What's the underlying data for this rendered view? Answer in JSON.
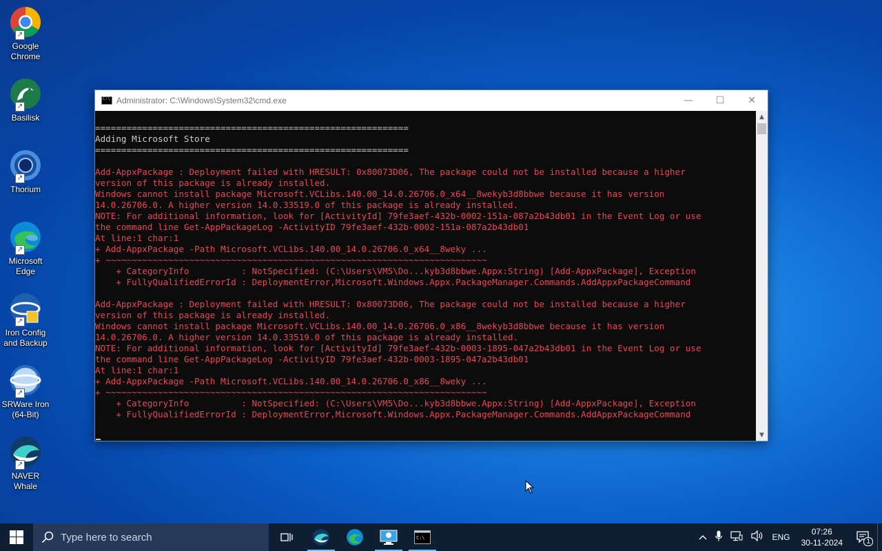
{
  "desktop": {
    "icons": [
      {
        "label": "Google\nChrome",
        "icon": "chrome-icon"
      },
      {
        "label": "Basilisk",
        "icon": "basilisk-icon"
      },
      {
        "label": "Thorium",
        "icon": "thorium-icon"
      },
      {
        "label": "Microsoft\nEdge",
        "icon": "edge-icon"
      },
      {
        "label": "Iron Config\nand Backup",
        "icon": "iron-config-icon"
      },
      {
        "label": "SRWare Iron\n(64-Bit)",
        "icon": "srware-iron-icon"
      },
      {
        "label": "NAVER\nWhale",
        "icon": "naver-whale-icon"
      }
    ]
  },
  "window": {
    "title": "Administrator: C:\\Windows\\System32\\cmd.exe",
    "minimize": "—",
    "maximize": "☐",
    "close": "✕"
  },
  "console": {
    "lines": [
      {
        "text": "============================================================",
        "color": "white"
      },
      {
        "text": "Adding Microsoft Store",
        "color": "white"
      },
      {
        "text": "============================================================",
        "color": "white"
      },
      {
        "text": "",
        "color": "white"
      },
      {
        "text": "Add-AppxPackage : Deployment failed with HRESULT: 0x80073D06, The package could not be installed because a higher",
        "color": "red"
      },
      {
        "text": "version of this package is already installed.",
        "color": "red"
      },
      {
        "text": "Windows cannot install package Microsoft.VCLibs.140.00_14.0.26706.0_x64__8wekyb3d8bbwe because it has version",
        "color": "red"
      },
      {
        "text": "14.0.26706.0. A higher version 14.0.33519.0 of this package is already installed.",
        "color": "red"
      },
      {
        "text": "NOTE: For additional information, look for [ActivityId] 79fe3aef-432b-0002-151a-087a2b43db01 in the Event Log or use",
        "color": "red"
      },
      {
        "text": "the command line Get-AppPackageLog -ActivityID 79fe3aef-432b-0002-151a-087a2b43db01",
        "color": "red"
      },
      {
        "text": "At line:1 char:1",
        "color": "red"
      },
      {
        "text": "+ Add-AppxPackage -Path Microsoft.VCLibs.140.00_14.0.26706.0_x64__8weky ...",
        "color": "red"
      },
      {
        "text": "+ ~~~~~~~~~~~~~~~~~~~~~~~~~~~~~~~~~~~~~~~~~~~~~~~~~~~~~~~~~~~~~~~~~~~~~~~~~",
        "color": "red"
      },
      {
        "text": "    + CategoryInfo          : NotSpecified: (C:\\Users\\VM5\\Do...kyb3d8bbwe.Appx:String) [Add-AppxPackage], Exception",
        "color": "red"
      },
      {
        "text": "    + FullyQualifiedErrorId : DeploymentError,Microsoft.Windows.Appx.PackageManager.Commands.AddAppxPackageCommand",
        "color": "red"
      },
      {
        "text": "",
        "color": "white"
      },
      {
        "text": "Add-AppxPackage : Deployment failed with HRESULT: 0x80073D06, The package could not be installed because a higher",
        "color": "red"
      },
      {
        "text": "version of this package is already installed.",
        "color": "red"
      },
      {
        "text": "Windows cannot install package Microsoft.VCLibs.140.00_14.0.26706.0_x86__8wekyb3d8bbwe because it has version",
        "color": "red"
      },
      {
        "text": "14.0.26706.0. A higher version 14.0.33519.0 of this package is already installed.",
        "color": "red"
      },
      {
        "text": "NOTE: For additional information, look for [ActivityId] 79fe3aef-432b-0003-1895-047a2b43db01 in the Event Log or use",
        "color": "red"
      },
      {
        "text": "the command line Get-AppPackageLog -ActivityID 79fe3aef-432b-0003-1895-047a2b43db01",
        "color": "red"
      },
      {
        "text": "At line:1 char:1",
        "color": "red"
      },
      {
        "text": "+ Add-AppxPackage -Path Microsoft.VCLibs.140.00_14.0.26706.0_x86__8weky ...",
        "color": "red"
      },
      {
        "text": "+ ~~~~~~~~~~~~~~~~~~~~~~~~~~~~~~~~~~~~~~~~~~~~~~~~~~~~~~~~~~~~~~~~~~~~~~~~~",
        "color": "red"
      },
      {
        "text": "    + CategoryInfo          : NotSpecified: (C:\\Users\\VM5\\Do...kyb3d8bbwe.Appx:String) [Add-AppxPackage], Exception",
        "color": "red"
      },
      {
        "text": "    + FullyQualifiedErrorId : DeploymentError,Microsoft.Windows.Appx.PackageManager.Commands.AddAppxPackageCommand",
        "color": "red"
      }
    ]
  },
  "taskbar": {
    "search_placeholder": "Type here to search",
    "apps": [
      {
        "icon": "task-view-icon",
        "active": false
      },
      {
        "icon": "naver-whale-icon",
        "active": true
      },
      {
        "icon": "edge-icon",
        "active": false
      },
      {
        "icon": "remote-desktop-icon",
        "active": true
      },
      {
        "icon": "cmd-icon",
        "active": true
      }
    ],
    "tray": {
      "language": "ENG",
      "time": "07:26",
      "date": "30-11-2024",
      "notification_count": "1"
    }
  },
  "colors": {
    "console_text": "#cccccc",
    "console_error": "#e74856",
    "console_bg": "#0c0c0c",
    "taskbar_bg": "#0e1e33"
  }
}
